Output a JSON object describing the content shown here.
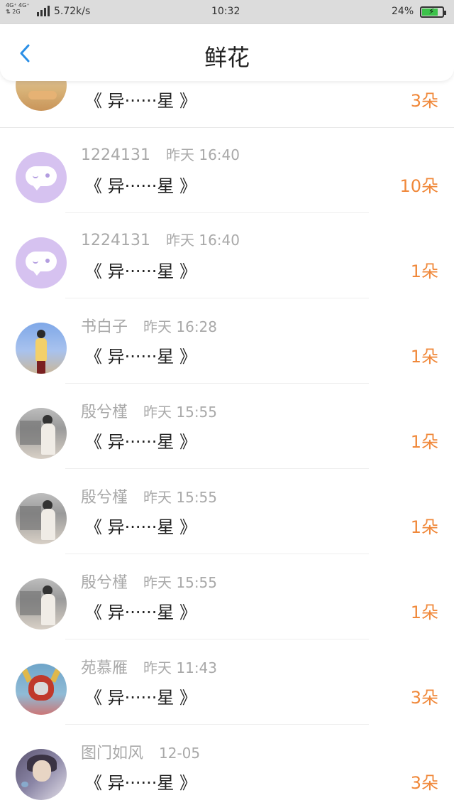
{
  "status_bar": {
    "network_top": "4G⁺ 4G⁺",
    "network_bottom": "⇅ 2G",
    "speed": "5.72k/s",
    "time": "10:32",
    "battery": "24%"
  },
  "nav": {
    "title": "鲜花"
  },
  "list": [
    {
      "name": "",
      "time": "",
      "message": "《 异······星 》",
      "count": "3朵",
      "avatar": "photo-person-top"
    },
    {
      "name": "1224131",
      "time": "昨天 16:40",
      "message": "《 异······星 》",
      "count": "10朵",
      "avatar": "chat-bubble-icon"
    },
    {
      "name": "1224131",
      "time": "昨天 16:40",
      "message": "《 异······星 》",
      "count": "1朵",
      "avatar": "chat-bubble-icon"
    },
    {
      "name": "书白子",
      "time": "昨天 16:28",
      "message": "《 异······星 》",
      "count": "1朵",
      "avatar": "photo-person-sky"
    },
    {
      "name": "殷兮槿",
      "time": "昨天 15:55",
      "message": "《 异······星 》",
      "count": "1朵",
      "avatar": "photo-scene"
    },
    {
      "name": "殷兮槿",
      "time": "昨天 15:55",
      "message": "《 异······星 》",
      "count": "1朵",
      "avatar": "photo-scene"
    },
    {
      "name": "殷兮槿",
      "time": "昨天 15:55",
      "message": "《 异······星 》",
      "count": "1朵",
      "avatar": "photo-scene"
    },
    {
      "name": "苑慕雁",
      "time": "昨天 11:43",
      "message": "《 异······星 》",
      "count": "3朵",
      "avatar": "photo-hero"
    },
    {
      "name": "图门如风",
      "time": "12-05",
      "message": "《 异······星 》",
      "count": "3朵",
      "avatar": "photo-art"
    }
  ],
  "colors": {
    "accent_count": "#f0883a",
    "back_icon": "#2b8fe6",
    "status_bar_bg": "#dcdcdc"
  }
}
